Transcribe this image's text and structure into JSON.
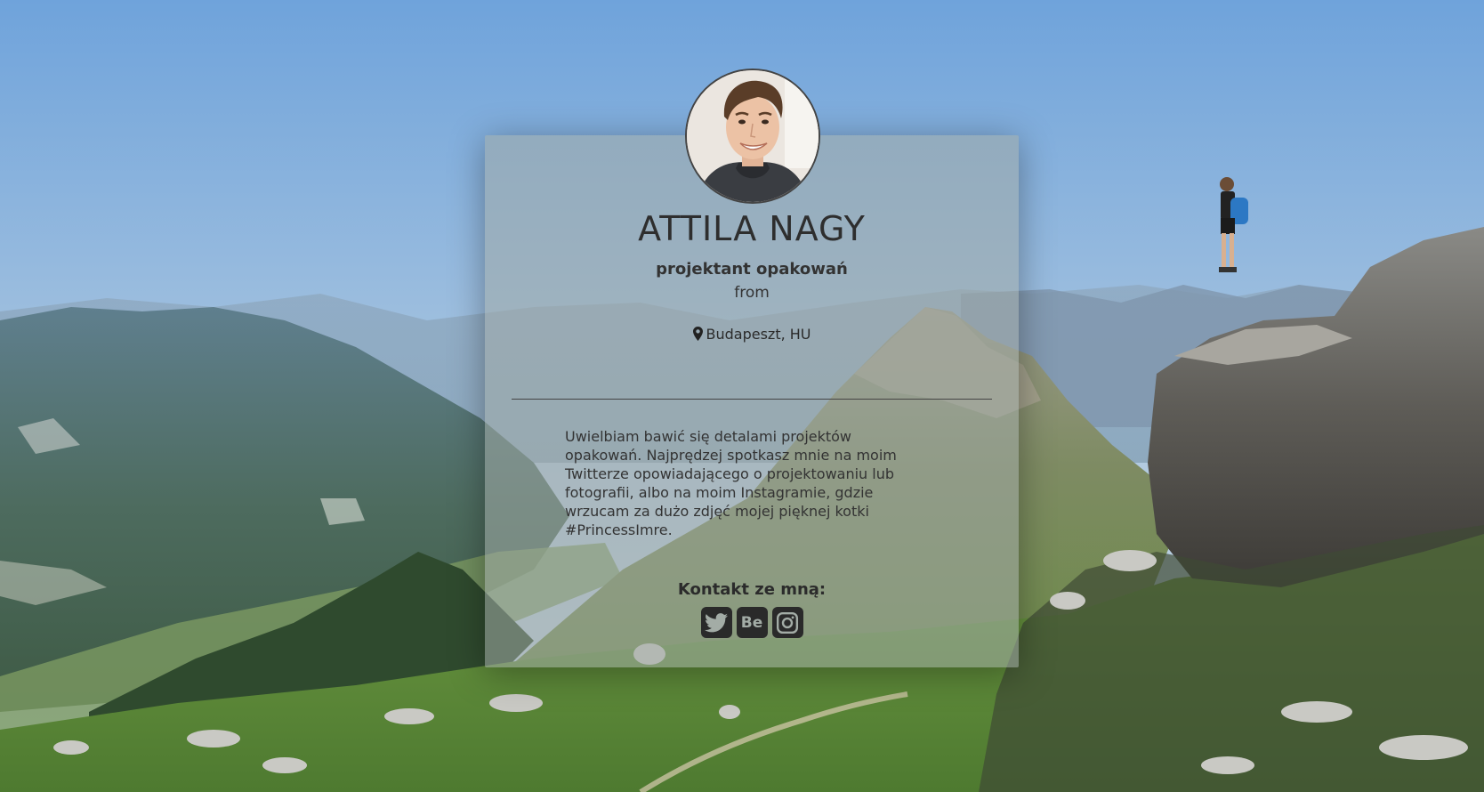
{
  "profile": {
    "name": "ATTILA NAGY",
    "job_title": "projektant opakowań",
    "from_label": "from",
    "location": "Budapeszt, HU",
    "bio": "Uwielbiam bawić się detalami projektów opakowań. Najprędzej spotkasz mnie na moim Twitterze opowiadającego o projektowaniu lub fotografii, albo na moim Instagramie, gdzie wrzucam za dużo zdjęć mojej pięknej kotki #PrincessImre.",
    "contact_label": "Kontakt ze mną:"
  },
  "social": [
    {
      "icon": "twitter-icon",
      "label": "Twitter"
    },
    {
      "icon": "behance-icon",
      "label": "Be"
    },
    {
      "icon": "instagram-icon",
      "label": "Instagram"
    }
  ],
  "colors": {
    "card_overlay": "#a0aaa5",
    "text": "#2e2e2e",
    "icon_bg": "#2a2a2a",
    "sky_top": "#6fa3db",
    "sky_horizon": "#bcd3e4"
  }
}
